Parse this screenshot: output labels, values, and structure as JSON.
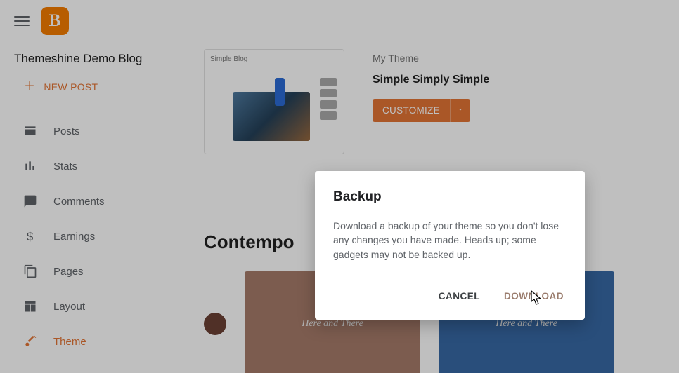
{
  "blog_title": "Themeshine Demo Blog",
  "new_post_label": "NEW POST",
  "nav": {
    "posts": "Posts",
    "stats": "Stats",
    "comments": "Comments",
    "earnings": "Earnings",
    "pages": "Pages",
    "layout": "Layout",
    "theme": "Theme"
  },
  "theme": {
    "meta_label": "My Theme",
    "name": "Simple Simply Simple",
    "preview_title": "Simple Blog",
    "customize_label": "CUSTOMIZE"
  },
  "section_title": "Contempo",
  "card_text": "Here and There",
  "modal": {
    "title": "Backup",
    "body": "Download a backup of your theme so you don't lose any changes you have made. Heads up; some gadgets may not be backed up.",
    "cancel": "CANCEL",
    "download": "DOWNLOAD"
  }
}
